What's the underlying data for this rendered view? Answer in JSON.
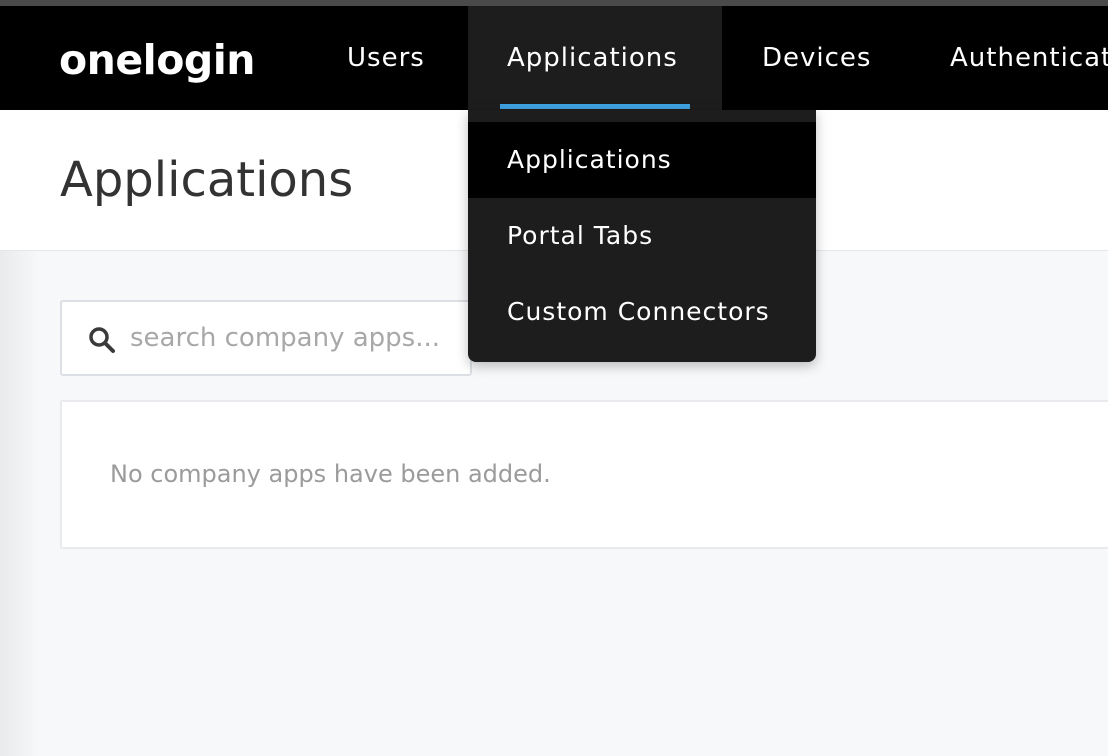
{
  "brand": {
    "logo": "onelogin"
  },
  "nav": {
    "items": [
      {
        "label": "Users"
      },
      {
        "label": "Applications"
      },
      {
        "label": "Devices"
      },
      {
        "label": "Authenticat"
      }
    ],
    "active_index": 1,
    "accent_color": "#3ea1e0"
  },
  "dropdown": {
    "items": [
      {
        "label": "Applications",
        "active": true
      },
      {
        "label": "Portal Tabs",
        "active": false
      },
      {
        "label": "Custom Connectors",
        "active": false
      }
    ]
  },
  "page": {
    "title": "Applications",
    "search": {
      "placeholder": "search company apps...",
      "value": "",
      "icon": "search-icon"
    },
    "empty_message": "No company apps have been added."
  }
}
